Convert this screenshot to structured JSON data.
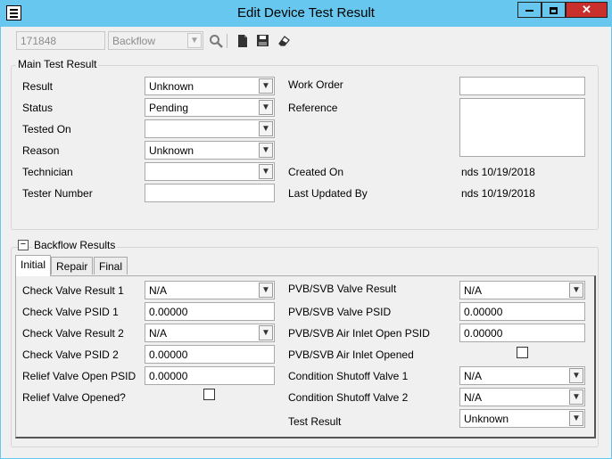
{
  "window": {
    "title": "Edit Device Test Result",
    "close_glyph": "✕"
  },
  "toolbar": {
    "record_id": "171848",
    "device_type": "Backflow",
    "icons": [
      "search-icon",
      "new-document-icon",
      "save-icon",
      "eraser-icon"
    ]
  },
  "main_group": {
    "legend": "Main Test Result",
    "result_label": "Result",
    "result_value": "Unknown",
    "status_label": "Status",
    "status_value": "Pending",
    "tested_on_label": "Tested On",
    "tested_on_value": "",
    "reason_label": "Reason",
    "reason_value": "Unknown",
    "technician_label": "Technician",
    "technician_value": "",
    "tester_number_label": "Tester Number",
    "tester_number_value": "",
    "work_order_label": "Work Order",
    "work_order_value": "",
    "reference_label": "Reference",
    "reference_value": "",
    "created_on_label": "Created On",
    "created_on_value": "nds 10/19/2018",
    "last_updated_label": "Last Updated By",
    "last_updated_value": "nds 10/19/2018"
  },
  "backflow_group": {
    "legend": "Backflow Results",
    "collapse_glyph": "−",
    "tabs": [
      {
        "label": "Initial",
        "active": true
      },
      {
        "label": "Repair",
        "active": false
      },
      {
        "label": "Final",
        "active": false
      }
    ],
    "left": {
      "cv_result1_label": "Check Valve Result 1",
      "cv_result1_value": "N/A",
      "cv_psid1_label": "Check Valve PSID 1",
      "cv_psid1_value": "0.00000",
      "cv_result2_label": "Check Valve Result 2",
      "cv_result2_value": "N/A",
      "cv_psid2_label": "Check Valve PSID 2",
      "cv_psid2_value": "0.00000",
      "rv_open_psid_label": "Relief Valve Open PSID",
      "rv_open_psid_value": "0.00000",
      "rv_opened_label": "Relief Valve Opened?",
      "rv_opened_checked": false
    },
    "right": {
      "pvb_result_label": "PVB/SVB Valve Result",
      "pvb_result_value": "N/A",
      "pvb_psid_label": "PVB/SVB Valve PSID",
      "pvb_psid_value": "0.00000",
      "pvb_air_psid_label": "PVB/SVB Air Inlet Open PSID",
      "pvb_air_psid_value": "0.00000",
      "pvb_air_opened_label": "PVB/SVB Air Inlet Opened",
      "pvb_air_opened_checked": false,
      "shutoff1_label": "Condition Shutoff Valve 1",
      "shutoff1_value": "N/A",
      "shutoff2_label": "Condition Shutoff Valve 2",
      "shutoff2_value": "N/A",
      "test_result_label": "Test Result",
      "test_result_value": "Unknown"
    }
  }
}
